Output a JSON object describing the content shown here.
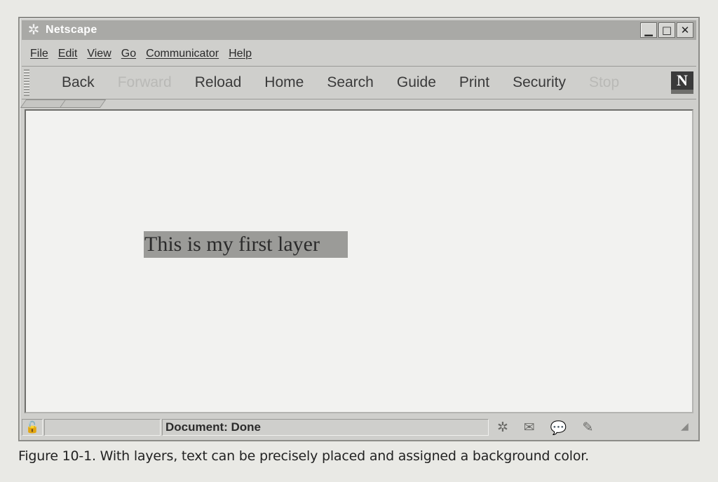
{
  "window": {
    "title": "Netscape",
    "app_icon": "✲"
  },
  "window_buttons": {
    "minimize": "▁",
    "maximize": "□",
    "close": "✕"
  },
  "menu": [
    "File",
    "Edit",
    "View",
    "Go",
    "Communicator",
    "Help"
  ],
  "toolbar": {
    "buttons": [
      {
        "label": "Back",
        "enabled": true
      },
      {
        "label": "Forward",
        "enabled": false
      },
      {
        "label": "Reload",
        "enabled": true
      },
      {
        "label": "Home",
        "enabled": true
      },
      {
        "label": "Search",
        "enabled": true
      },
      {
        "label": "Guide",
        "enabled": true
      },
      {
        "label": "Print",
        "enabled": true
      },
      {
        "label": "Security",
        "enabled": true
      },
      {
        "label": "Stop",
        "enabled": false
      }
    ],
    "logo": "N"
  },
  "content": {
    "layer_text": "This is my first layer"
  },
  "status": {
    "text": "Document: Done",
    "icons": [
      "navigator-icon",
      "mail-icon",
      "discussion-icon",
      "composer-icon"
    ]
  },
  "caption": "Figure 10-1. With layers, text can be precisely placed and assigned a background color."
}
